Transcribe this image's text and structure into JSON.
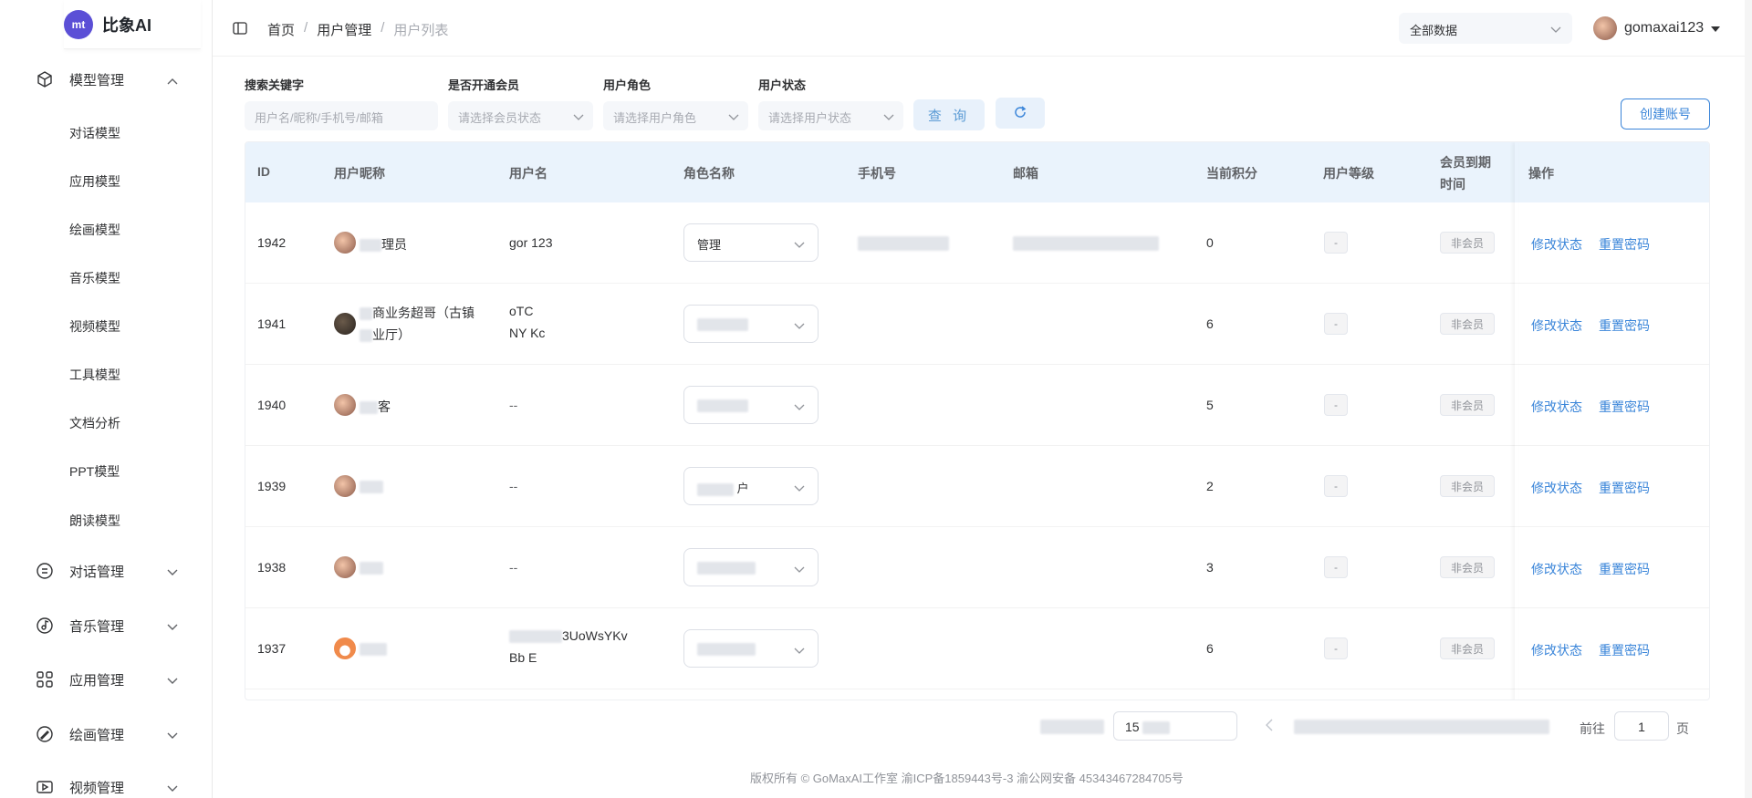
{
  "app": {
    "logo_mark": "mt",
    "logo_text": "比象AI"
  },
  "sidebar": {
    "model_group": "模型管理",
    "sub_items": [
      "对话模型",
      "应用模型",
      "绘画模型",
      "音乐模型",
      "视频模型",
      "工具模型",
      "文档分析",
      "PPT模型",
      "朗读模型"
    ],
    "groups": [
      "对话管理",
      "音乐管理",
      "应用管理",
      "绘画管理",
      "视频管理"
    ]
  },
  "header": {
    "breadcrumb": [
      "首页",
      "用户管理",
      "用户列表"
    ],
    "data_select": "全部数据",
    "username": "gomaxai123"
  },
  "filters": {
    "keyword_label": "搜索关键字",
    "keyword_placeholder": "用户名/昵称/手机号/邮箱",
    "member_label": "是否开通会员",
    "member_placeholder": "请选择会员状态",
    "role_label": "用户角色",
    "role_placeholder": "请选择用户角色",
    "status_label": "用户状态",
    "status_placeholder": "请选择用户状态",
    "query_button": "查 询",
    "create_button": "创建账号"
  },
  "table": {
    "headers": [
      "ID",
      "用户昵称",
      "用户名",
      "角色名称",
      "手机号",
      "邮箱",
      "当前积分",
      "用户等级",
      "会员到期时间",
      "操作"
    ],
    "header_member_line1": "会员到期",
    "header_member_line2": "时间",
    "rows": [
      {
        "id": "1942",
        "nickname": "理员",
        "username": "gor 123",
        "role": "管理",
        "points": "0",
        "level": "-",
        "member": "非会员"
      },
      {
        "id": "1941",
        "nickname_l1": "商业务超哥（古镇",
        "nickname_l2": "业厅）",
        "username_l1": "oTC",
        "username_l2": "NY Kc",
        "role": "",
        "points": "6",
        "level": "-",
        "member": "非会员"
      },
      {
        "id": "1940",
        "nickname": "客",
        "username": "--",
        "role": "",
        "points": "5",
        "level": "-",
        "member": "非会员"
      },
      {
        "id": "1939",
        "nickname": "",
        "username": "--",
        "role": "户",
        "points": "2",
        "level": "-",
        "member": "非会员"
      },
      {
        "id": "1938",
        "nickname": "",
        "username": "--",
        "role": "",
        "points": "3",
        "level": "-",
        "member": "非会员"
      },
      {
        "id": "1937",
        "nickname": "",
        "username_l1": "3UoWsYKv",
        "username_l2": "Bb E",
        "role": "",
        "points": "6",
        "level": "-",
        "member": "非会员"
      }
    ],
    "op_change_status": "修改状态",
    "op_reset_password": "重置密码"
  },
  "pagination": {
    "page_size": "15",
    "goto_label": "前往",
    "goto_value": "1",
    "page_suffix": "页"
  },
  "footer": "版权所有 © GoMaxAI工作室   渝ICP备1859443号-3   渝公网安备 45343467284705号",
  "colors": {
    "accent": "#3a85d9",
    "header_bg": "#eaf3fc"
  }
}
